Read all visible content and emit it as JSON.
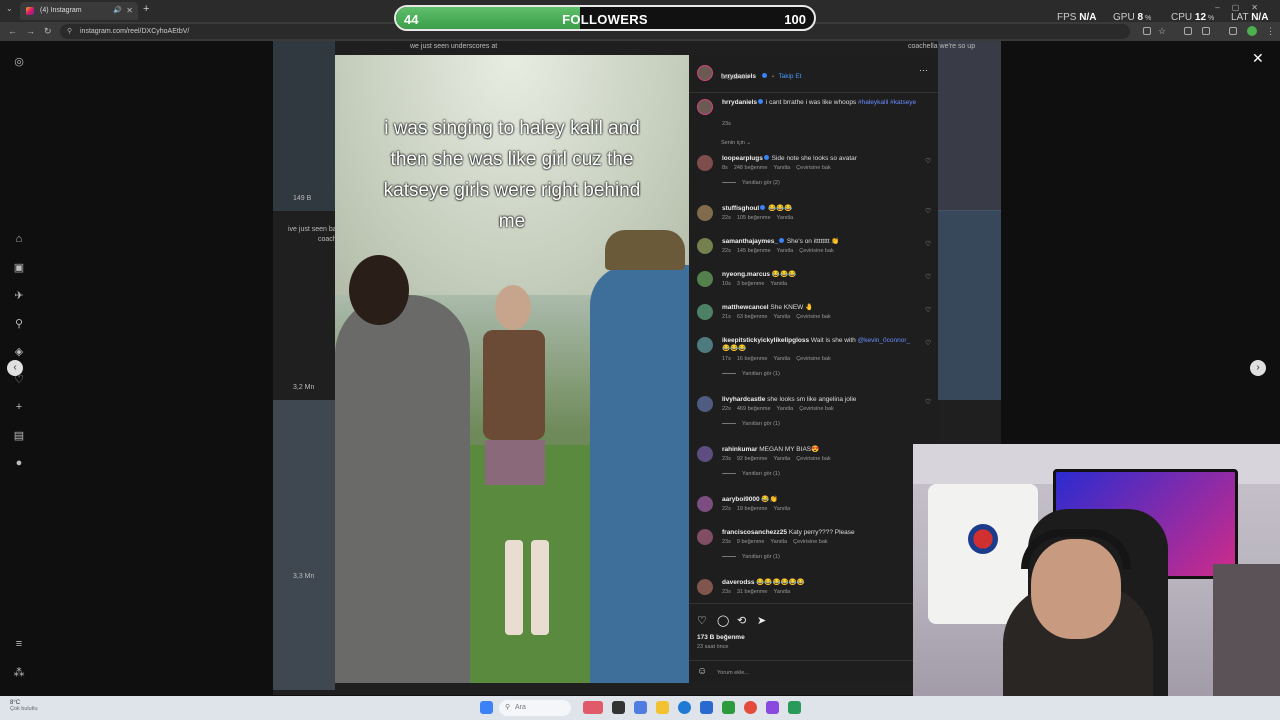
{
  "browser": {
    "tab_title": "(4) Instagram",
    "url": "instagram.com/reel/DXCyhoAEtbV/"
  },
  "overlay": {
    "followers_current": "44",
    "followers_label": "FOLLOWERS",
    "followers_goal": "100",
    "followers_progress": 0.44,
    "fps_label": "FPS",
    "fps_value": "N/A",
    "gpu_label": "GPU",
    "gpu_value": "8",
    "cpu_label": "CPU",
    "cpu_value": "12",
    "lat_label": "LAT",
    "lat_value": "N/A"
  },
  "background_grid": {
    "texts": [
      "we just seen underscores at",
      "coachella we're so up",
      "149 B",
      "ive just seen ba",
      "coach",
      "3,2 Mn",
      "3,3 Mn"
    ]
  },
  "post": {
    "caption_lines": [
      "i was singing to haley kalil and",
      "then she was like girl cuz the",
      "katseye girls were right behind",
      "me"
    ],
    "author": "hrrydaniels",
    "follow": "Takip Et",
    "audio": "Orijinal ses",
    "description": "i cant brrathe i was like whoops",
    "hashtags": "#haleykalil #katseye",
    "description_age": "23s",
    "sort_label": "Senin için",
    "likes": "173 B beğenme",
    "posted": "23 saat önce",
    "comment_placeholder": "Yorum ekle..."
  },
  "comments": [
    {
      "user": "loopearplugs",
      "verified": true,
      "text": "Side note she looks so avatar",
      "meta": [
        "8s",
        "248 beğenme",
        "Yanıtla",
        "Çevirisine bak"
      ],
      "replies": "Yanıtları gör (2)"
    },
    {
      "user": "stuffisghoul",
      "verified": true,
      "text": "😂😂😂",
      "meta": [
        "22s",
        "105 beğenme",
        "Yanıtla"
      ],
      "replies": ""
    },
    {
      "user": "samanthajaymes_",
      "verified": true,
      "text": "She's on itttttttt 👏",
      "meta": [
        "22s",
        "145 beğenme",
        "Yanıtla",
        "Çevirisine bak"
      ],
      "replies": ""
    },
    {
      "user": "nyeong.marcus",
      "verified": false,
      "text": "😂😂😂",
      "meta": [
        "10s",
        "3 beğenme",
        "Yanıtla"
      ],
      "replies": ""
    },
    {
      "user": "matthewcancel",
      "verified": false,
      "text": "She KNEW 🤚",
      "meta": [
        "21s",
        "63 beğenme",
        "Yanıtla",
        "Çevirisine bak"
      ],
      "replies": ""
    },
    {
      "user": "ikeepitstickyickylikelipgloss",
      "verified": false,
      "text": "Wait is she with",
      "mention": "@kevin_0connor_",
      "text2": "😂😂😂",
      "meta": [
        "17s",
        "16 beğenme",
        "Yanıtla",
        "Çevirisine bak"
      ],
      "replies": "Yanıtları gör (1)"
    },
    {
      "user": "livyhardcastle",
      "verified": false,
      "text": "she looks sm like angelina jolie",
      "meta": [
        "22s",
        "469 beğenme",
        "Yanıtla",
        "Çevirisine bak"
      ],
      "replies": "Yanıtları gör (1)"
    },
    {
      "user": "rahinkumar",
      "verified": false,
      "text": "MEGAN MY BIAS😍",
      "meta": [
        "23s",
        "92 beğenme",
        "Yanıtla",
        "Çevirisine bak"
      ],
      "replies": "Yanıtları gör (1)"
    },
    {
      "user": "aaryboi9000",
      "verified": false,
      "text": "😂👏",
      "meta": [
        "22s",
        "19 beğenme",
        "Yanıtla"
      ],
      "replies": ""
    },
    {
      "user": "franciscosanchezz25",
      "verified": false,
      "text": "Katy perry???? Please",
      "meta": [
        "23s",
        "9 beğenme",
        "Yanıtla",
        "Çevirisine bak"
      ],
      "replies": "Yanıtları gör (1)"
    },
    {
      "user": "daverodss",
      "verified": false,
      "text": "😂😂😂😂😂😂",
      "meta": [
        "23s",
        "31 beğenme",
        "Yanıtla"
      ],
      "replies": ""
    }
  ],
  "taskbar": {
    "weather_temp": "8°C",
    "weather_desc": "Çok bulutlu",
    "search_placeholder": "Ara"
  },
  "icons": {
    "heart": "♡",
    "comment": "◯",
    "repost": "⟲",
    "share": "➤",
    "more": "···",
    "close": "✕",
    "next": "›",
    "prev": "‹",
    "emoji": "☺"
  }
}
